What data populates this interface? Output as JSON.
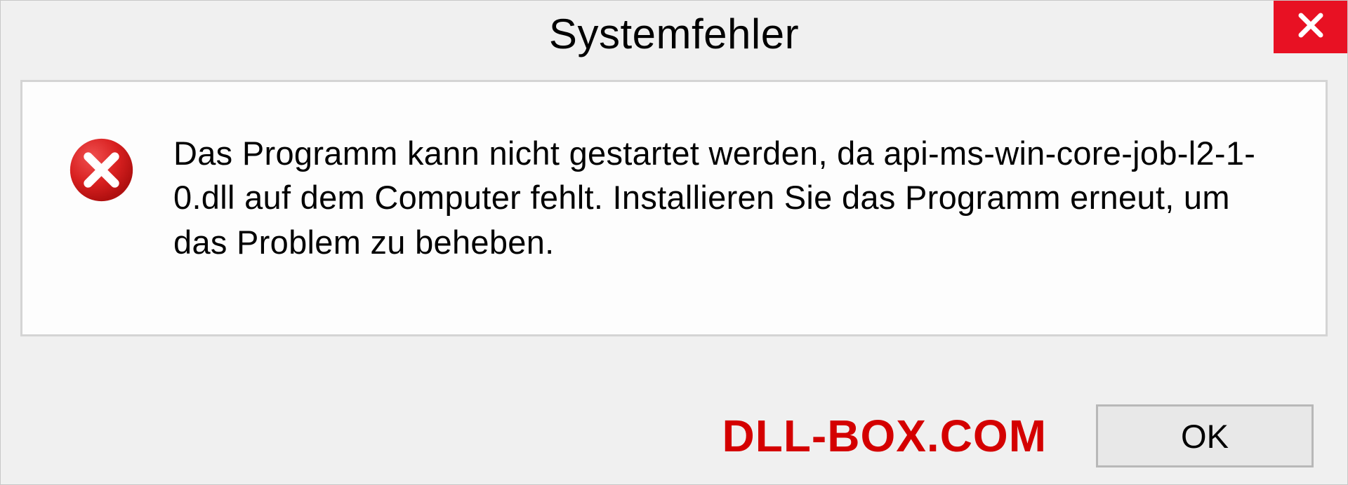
{
  "window": {
    "title": "Systemfehler",
    "close_icon": "close"
  },
  "content": {
    "error_icon": "error",
    "message": "Das Programm kann nicht gestartet werden, da api-ms-win-core-job-l2-1-0.dll auf dem Computer fehlt. Installieren Sie das Programm erneut, um das Problem zu beheben."
  },
  "footer": {
    "watermark": "DLL-BOX.COM",
    "ok_label": "OK"
  }
}
